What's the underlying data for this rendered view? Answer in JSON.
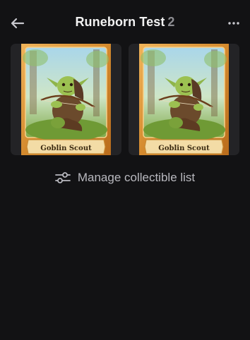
{
  "header": {
    "title": "Runeborn Test",
    "count": "2",
    "back_icon": "arrow-left-icon",
    "more_icon": "more-horizontal-icon"
  },
  "collectibles": [
    {
      "name": "Goblin Scout"
    },
    {
      "name": "Goblin Scout"
    }
  ],
  "manage": {
    "label": "Manage collectible list",
    "icon": "sliders-icon"
  },
  "colors": {
    "background": "#121214",
    "tile": "#232326",
    "card_frame": "#d48a2e",
    "card_plaque": "#f3dca6",
    "muted_text": "#b9b9bf"
  }
}
